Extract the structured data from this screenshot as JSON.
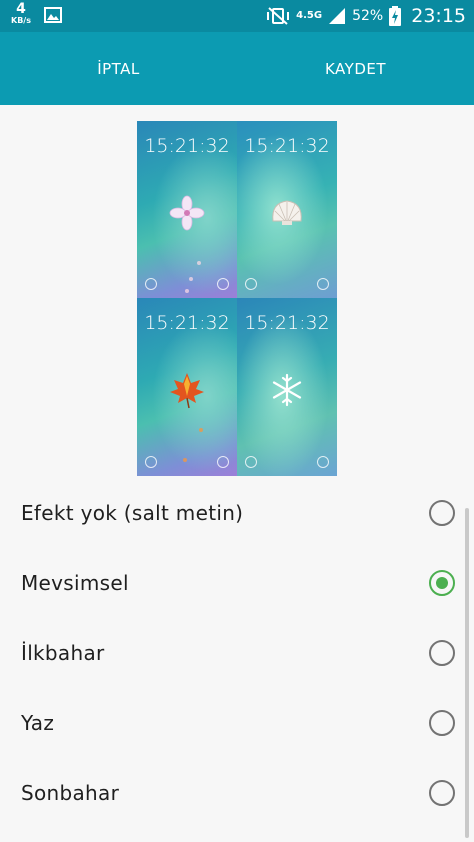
{
  "status_bar": {
    "speed_value": "4",
    "speed_unit": "KB/s",
    "network": "4.5G",
    "battery_percent": "52%",
    "time": "23:15"
  },
  "action_bar": {
    "cancel_label": "İPTAL",
    "save_label": "KAYDET"
  },
  "preview": {
    "tiles": [
      {
        "time": "15:21:32",
        "icon": "flower-icon"
      },
      {
        "time": "15:21:32",
        "icon": "seashell-icon"
      },
      {
        "time": "15:21:32",
        "icon": "maple-leaf-icon"
      },
      {
        "time": "15:21:32",
        "icon": "snowflake-icon"
      }
    ]
  },
  "options": [
    {
      "label": "Efekt yok (salt metin)",
      "selected": false
    },
    {
      "label": "Mevsimsel",
      "selected": true
    },
    {
      "label": "İlkbahar",
      "selected": false
    },
    {
      "label": "Yaz",
      "selected": false
    },
    {
      "label": "Sonbahar",
      "selected": false
    }
  ],
  "colors": {
    "status_bar": "#0a8aa0",
    "action_bar": "#0c9bb2",
    "radio_selected": "#4caf50",
    "radio_unselected": "#737373"
  }
}
